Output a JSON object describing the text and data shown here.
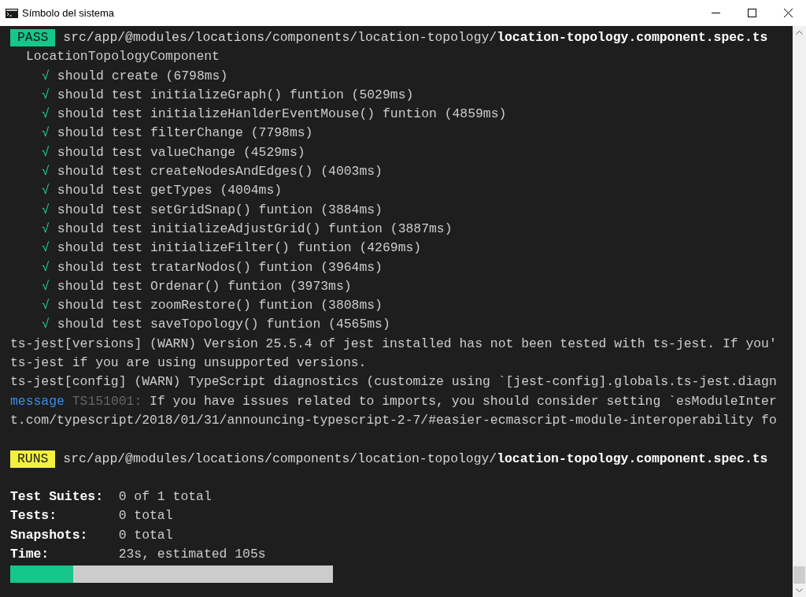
{
  "window": {
    "title": "Símbolo del sistema"
  },
  "results": [
    {
      "status": "PASS",
      "path_dir": "src/app/@modules/locations/components/location-topology/",
      "path_file": "location-topology.component.spec.ts",
      "suite": "LocationTopologyComponent",
      "tests": [
        {
          "mark": "√",
          "name": "should create (6798ms)",
          "passed": true
        },
        {
          "mark": "√",
          "name": "should test initializeGraph() funtion (5029ms)",
          "passed": true
        },
        {
          "mark": "√",
          "name": "should test initializeHanlderEventMouse() funtion (4859ms)",
          "passed": true
        },
        {
          "mark": "√",
          "name": "should test filterChange (7798ms)",
          "passed": true
        },
        {
          "mark": "√",
          "name": "should test valueChange (4529ms)",
          "passed": true
        },
        {
          "mark": "√",
          "name": "should test createNodesAndEdges() (4003ms)",
          "passed": true
        },
        {
          "mark": "√",
          "name": "should test getTypes (4004ms)",
          "passed": true
        },
        {
          "mark": "√",
          "name": "should test setGridSnap() funtion (3884ms)",
          "passed": true
        },
        {
          "mark": "√",
          "name": "should test initializeAdjustGrid() funtion (3887ms)",
          "passed": true
        },
        {
          "mark": "√",
          "name": "should test initializeFilter() funtion (4269ms)",
          "passed": true
        },
        {
          "mark": "√",
          "name": "should test tratarNodos() funtion (3964ms)",
          "passed": true
        },
        {
          "mark": "√",
          "name": "should test Ordenar() funtion (3973ms)",
          "passed": true
        },
        {
          "mark": "√",
          "name": "should test zoomRestore() funtion (3808ms)",
          "passed": true
        },
        {
          "mark": "√",
          "name": "should test saveTopology() funtion (4565ms)",
          "passed": true
        }
      ]
    }
  ],
  "log": [
    {
      "kind": "plain",
      "text": "ts-jest[versions] (WARN) Version 25.5.4 of jest installed has not been tested with ts-jest. If you'"
    },
    {
      "kind": "plain",
      "text": "ts-jest if you are using unsupported versions."
    },
    {
      "kind": "plain",
      "text": "ts-jest[config] (WARN) TypeScript diagnostics (customize using `[jest-config].globals.ts-jest.diagn"
    },
    {
      "kind": "message",
      "label": "message",
      "code": "TS151001:",
      "text": "If you have issues related to imports, you should consider setting `esModuleInter"
    },
    {
      "kind": "plain",
      "text": "t.com/typescript/2018/01/31/announcing-typescript-2-7/#easier-ecmascript-module-interoperability fo"
    }
  ],
  "running": {
    "status": "RUNS",
    "path_dir": "src/app/@modules/locations/components/location-topology/",
    "path_file": "location-topology.component.spec.ts"
  },
  "summary": [
    {
      "label": "Test Suites:",
      "value": "0 of 1 total"
    },
    {
      "label": "Tests:",
      "value": "0 total"
    },
    {
      "label": "Snapshots:",
      "value": "0 total"
    },
    {
      "label": "Time:",
      "value": "23s, estimated 105s"
    }
  ],
  "progress": {
    "level": 0.195
  }
}
